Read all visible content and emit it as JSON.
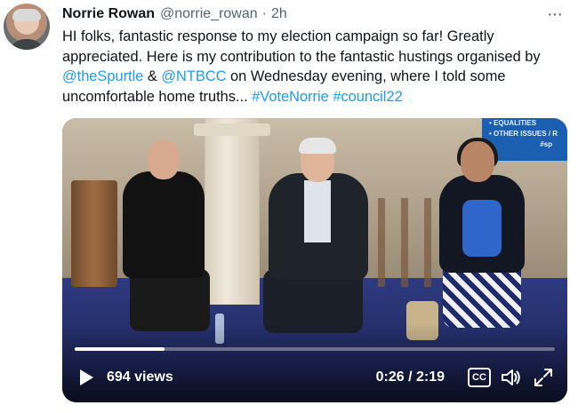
{
  "author": {
    "display_name": "Norrie Rowan",
    "handle": "@norrie_rowan",
    "separator": "·",
    "time": "2h"
  },
  "tweet": {
    "text_parts": [
      "HI folks, fantastic response to my election campaign so far! Greatly appreciated. Here is my contribution to the fantastic hustings organised by ",
      "@theSpurtle",
      " & ",
      "@NTBCC",
      " on Wednesday evening, where I told some uncomfortable home truths... ",
      "#VoteNorrie",
      "  ",
      "#council22"
    ]
  },
  "video": {
    "screen_lines": [
      "• EQUALITIES",
      "• OTHER ISSUES / R",
      "#sp"
    ],
    "views": "694 views",
    "timecode": "0:26 / 2:19",
    "progress_fraction": 0.187,
    "cc_label": "CC",
    "icons": {
      "play": "play-icon",
      "cc": "captions-icon",
      "volume": "volume-icon",
      "fullscreen": "fullscreen-icon"
    }
  },
  "ui": {
    "more_label": "···"
  }
}
